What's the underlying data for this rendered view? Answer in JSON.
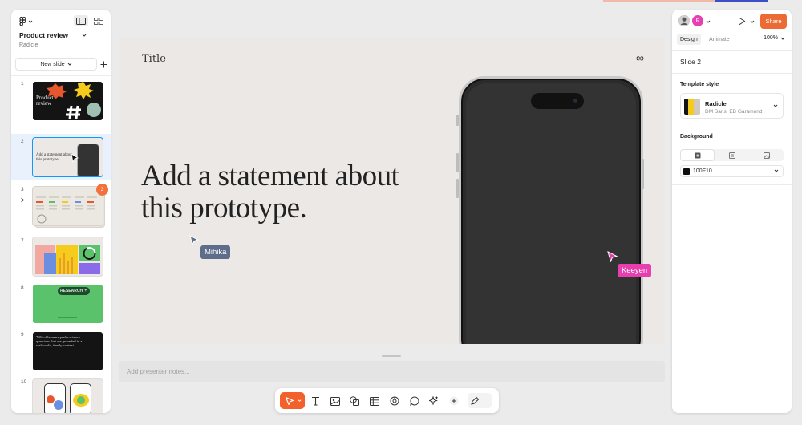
{
  "left_panel": {
    "file_name": "Product review",
    "team": "Radicle",
    "new_slide_label": "New slide",
    "slides": [
      {
        "number": "1",
        "thumb_title": "Product review"
      },
      {
        "number": "2",
        "thumb_title": "Add a statement about this prototype."
      },
      {
        "number": "3",
        "comment_count": "3"
      },
      {
        "number": "7"
      },
      {
        "number": "8",
        "thumb_title": "RESEARCH"
      },
      {
        "number": "9",
        "thumb_title": "76% of learners prefer science questions that are grounded in a real-world, timely context."
      },
      {
        "number": "10"
      }
    ]
  },
  "canvas": {
    "title": "Title",
    "logo": "∞",
    "statement": "Add a statement about this prototype.",
    "cursors": [
      {
        "name": "Mihika",
        "color": "#5d6d8a"
      },
      {
        "name": "Keeyen",
        "color": "#e83fb0"
      }
    ]
  },
  "notes": {
    "placeholder": "Add presenter notes..."
  },
  "toolbar": {
    "tools": [
      "move-tool",
      "text-tool",
      "image-tool",
      "shape-tool",
      "table-tool",
      "stamp-tool",
      "comment-tool",
      "actions-tool",
      "add-tool",
      "dev-mode-toggle"
    ]
  },
  "right_panel": {
    "avatar_initial": "R",
    "share_label": "Share",
    "tabs": [
      "Design",
      "Animate"
    ],
    "zoom": "100%",
    "slide_name": "Slide 2",
    "template_style_label": "Template style",
    "template": {
      "name": "Radicle",
      "fonts": "DM Sans, EB Garamond"
    },
    "background_label": "Background",
    "background_color": "100F10"
  },
  "colors": {
    "accent": "#f2612b",
    "selection": "#0d99ff",
    "slide_bg": "#ebe8e5",
    "share": "#ec6a33"
  }
}
